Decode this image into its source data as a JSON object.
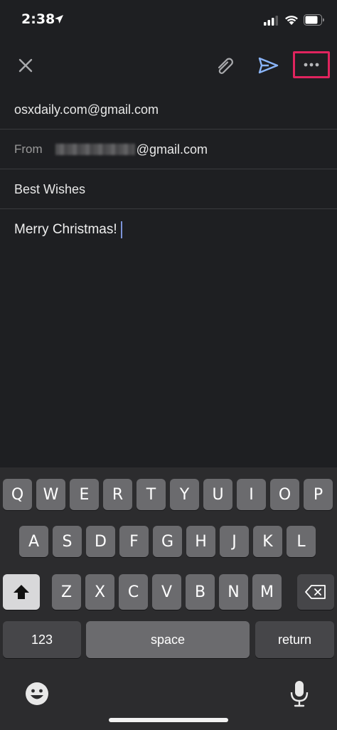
{
  "status_bar": {
    "time": "2:38"
  },
  "toolbar": {
    "close_icon": "close-icon",
    "attach_icon": "paperclip-icon",
    "send_icon": "send-icon",
    "more_icon": "more-horizontal-icon",
    "highlight_color": "#e0245e"
  },
  "compose": {
    "to": "osxdaily.com@gmail.com",
    "from_label": "From",
    "from_visible_suffix": "@gmail.com",
    "subject": "Best Wishes",
    "body": "Merry Christmas!"
  },
  "keyboard": {
    "row1": [
      "Q",
      "W",
      "E",
      "R",
      "T",
      "Y",
      "U",
      "I",
      "O",
      "P"
    ],
    "row2": [
      "A",
      "S",
      "D",
      "F",
      "G",
      "H",
      "J",
      "K",
      "L"
    ],
    "row3": [
      "Z",
      "X",
      "C",
      "V",
      "B",
      "N",
      "M"
    ],
    "numbers_label": "123",
    "space_label": "space",
    "return_label": "return",
    "shift_icon": "shift-icon",
    "delete_icon": "backspace-icon",
    "emoji_icon": "emoji-icon",
    "mic_icon": "microphone-icon"
  }
}
